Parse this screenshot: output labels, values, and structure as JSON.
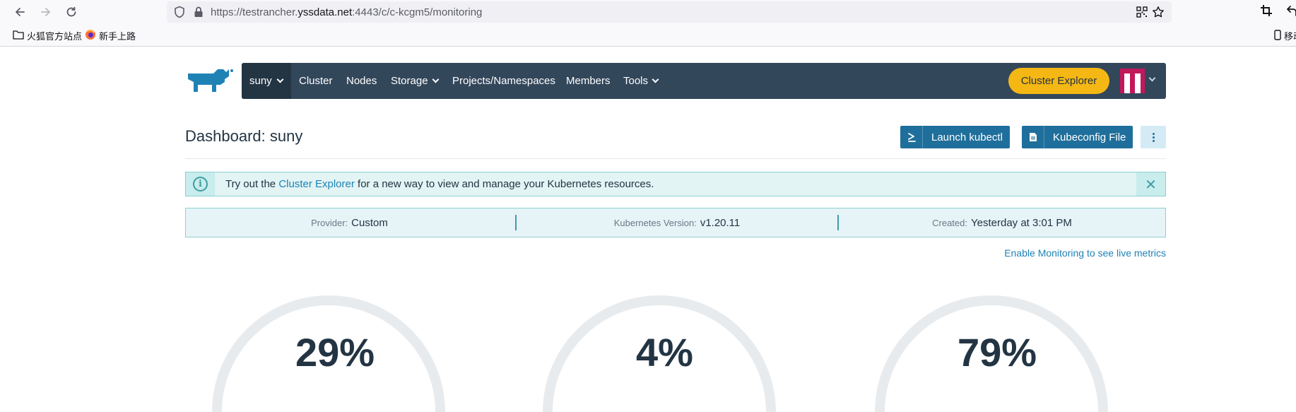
{
  "browser": {
    "url_prefix": "https://testrancher.",
    "url_host": "yssdata.net",
    "url_suffix": ":4443/c/c-kcgm5/monitoring",
    "bookmarks": [
      {
        "label": "火狐官方站点",
        "icon": "folder-icon"
      },
      {
        "label": "新手上路",
        "icon": "firefox-icon"
      }
    ],
    "mobile_bookmarks_label": "移动"
  },
  "nav": {
    "cluster_label": "suny",
    "items": [
      "Cluster",
      "Nodes",
      "Storage",
      "Projects/Namespaces",
      "Members",
      "Tools"
    ],
    "cluster_explorer_label": "Cluster Explorer"
  },
  "header": {
    "title": "Dashboard: suny",
    "launch_kubectl_label": "Launch kubectl",
    "kubeconfig_label": "Kubeconfig File"
  },
  "banner": {
    "prefix": "Try out the ",
    "link": "Cluster Explorer",
    "suffix": " for a new way to view and manage your Kubernetes resources."
  },
  "cluster_info": {
    "provider_key": "Provider:",
    "provider_value": "Custom",
    "version_key": "Kubernetes Version:",
    "version_value": "v1.20.11",
    "created_key": "Created:",
    "created_value": "Yesterday at 3:01 PM"
  },
  "monitoring_link": "Enable Monitoring to see live metrics",
  "gauges": [
    {
      "value": "29%"
    },
    {
      "value": "4%"
    },
    {
      "value": "79%"
    }
  ],
  "colors": {
    "navbar": "#33475b",
    "navbar_active": "#233443",
    "accent_yellow": "#f5b713",
    "button_blue": "#1f6f9c",
    "link_blue": "#1f82b5",
    "banner_teal": "#e2f4f4"
  }
}
